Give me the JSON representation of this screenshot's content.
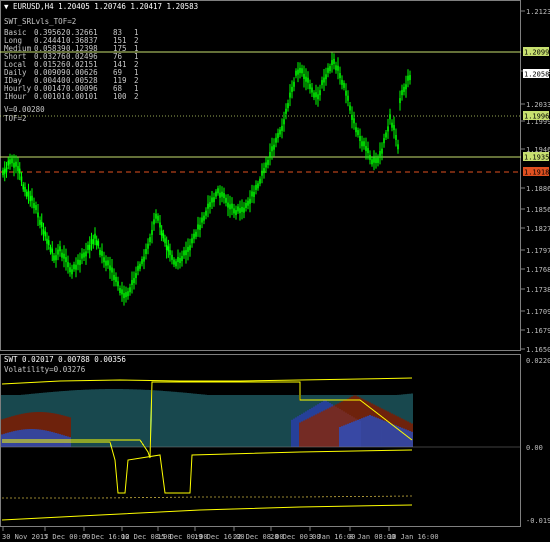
{
  "main": {
    "title": "EURUSD,H4  1.20405 1.20746 1.20417 1.20583",
    "indicator_name": "SWT_SRLvls_TOF=2",
    "rows": [
      {
        "name": "Basic",
        "v1": "0.39562",
        "v2": "0.32661",
        "n": "83",
        "k": "1"
      },
      {
        "name": "Long",
        "v1": "0.24441",
        "v2": "0.36837",
        "n": "151",
        "k": "2"
      },
      {
        "name": "Medium",
        "v1": "0.05839",
        "v2": "0.12398",
        "n": "175",
        "k": "1"
      },
      {
        "name": "Short",
        "v1": "0.03276",
        "v2": "0.02496",
        "n": "76",
        "k": "1"
      },
      {
        "name": "Local",
        "v1": "0.01526",
        "v2": "0.02151",
        "n": "141",
        "k": "2"
      },
      {
        "name": "Daily",
        "v1": "0.00909",
        "v2": "0.00626",
        "n": "69",
        "k": "1"
      },
      {
        "name": "IDay",
        "v1": "0.00440",
        "v2": "0.00528",
        "n": "119",
        "k": "2"
      },
      {
        "name": "Hourly",
        "v1": "0.00147",
        "v2": "0.00096",
        "n": "68",
        "k": "1"
      },
      {
        "name": "IHour",
        "v1": "0.00101",
        "v2": "0.00101",
        "n": "100",
        "k": "2"
      }
    ],
    "tof_label": "TOF=2",
    "v_label": "V=0.00280",
    "price_axis": [
      "1.21235",
      "1.20583",
      "1.20335",
      "1.19990",
      "1.19460",
      "1.18860",
      "1.18565",
      "1.18270",
      "1.17975",
      "1.17680",
      "1.17385",
      "1.17090",
      "1.16795",
      "1.16500"
    ],
    "level_tags": [
      {
        "value": "1.20990",
        "color": "#c8e070"
      },
      {
        "value": "1.20583",
        "color": "#ffffff"
      },
      {
        "value": "1.19960",
        "color": "#c8e070"
      },
      {
        "value": "1.19350",
        "color": "#c8e070"
      },
      {
        "value": "1.19185",
        "color": "#e05020"
      }
    ]
  },
  "sub": {
    "title": "SWT 0.02017 0.00788 0.00356",
    "volatility": "Volatility=0.03276",
    "axis": [
      "0.02206",
      "0.00",
      "-0.01944"
    ]
  },
  "time_axis": [
    "30 Nov 2017",
    "5 Dec 00:00",
    "7 Dec 16:00",
    "12 Dec 08:00",
    "15 Dec 00:00",
    "19 Dec 16:00",
    "22 Dec 08:00",
    "28 Dec 00:00",
    "3 Jan 16:00",
    "8 Jan 08:00",
    "10 Jan 16:00"
  ],
  "colors": {
    "candle": "#00ff00",
    "level": "#c8e070",
    "dash_level": "#e05020",
    "grid_border": "#7f7f7f",
    "osc_yellow": "#ffff00",
    "hist_cyan": "#40c0d0",
    "hist_blue": "#3050c0",
    "hist_brown": "#8a2a10"
  }
}
